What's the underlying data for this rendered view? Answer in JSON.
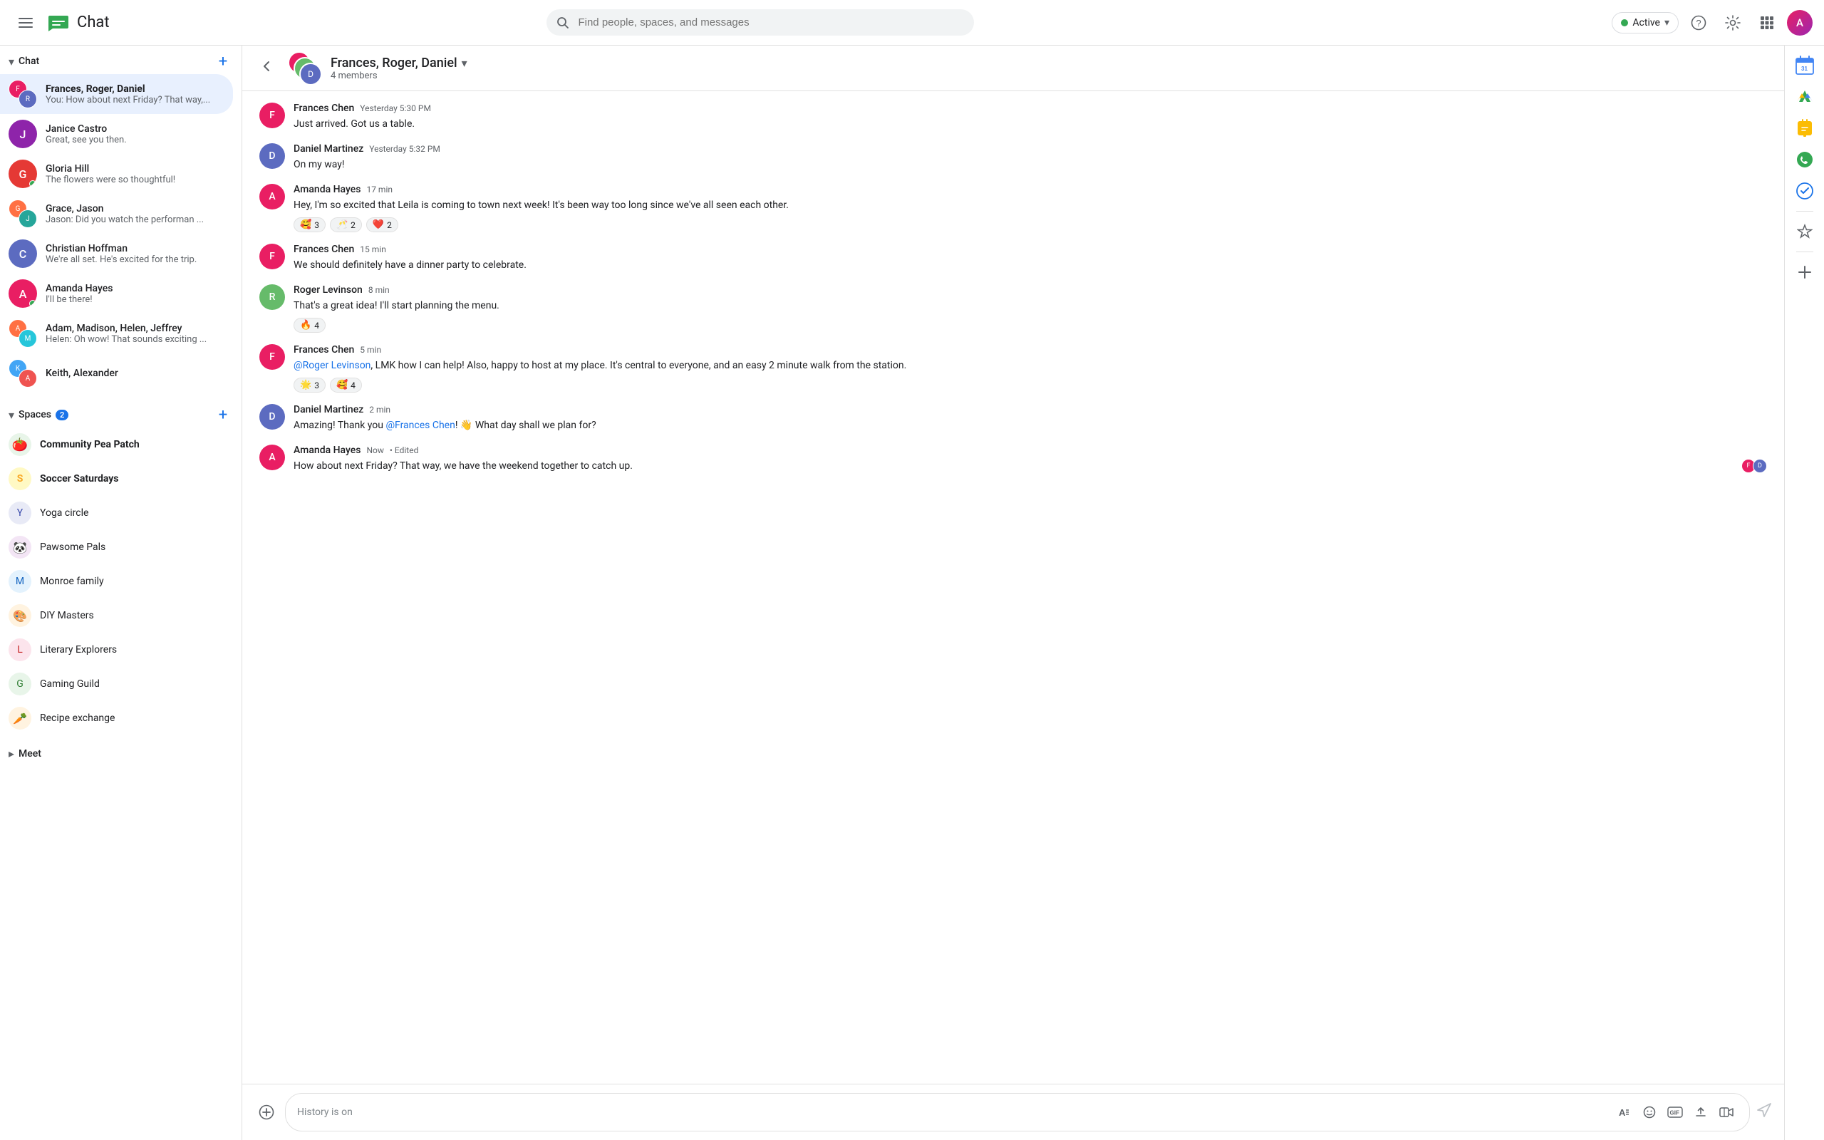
{
  "app": {
    "title": "Chat",
    "logo_color": "#34a853"
  },
  "global_header": {
    "search_placeholder": "Find people, spaces, and messages",
    "status_label": "Active",
    "status_color": "#34a853"
  },
  "sidebar": {
    "chat_section": {
      "label": "Chat",
      "add_icon": "+"
    },
    "spaces_section": {
      "label": "Spaces",
      "badge": "2",
      "add_icon": "+"
    },
    "meet_section": {
      "label": "Meet"
    },
    "conversations": [
      {
        "id": "conv1",
        "name": "Frances, Roger, Daniel",
        "preview": "You: How about next Friday? That way,...",
        "active": true,
        "type": "group",
        "avatar_colors": [
          "#e91e63",
          "#5c6bc0",
          "#66bb6a"
        ]
      },
      {
        "id": "conv2",
        "name": "Janice Castro",
        "preview": "Great, see you then.",
        "active": false,
        "type": "single",
        "avatar_color": "#8e24aa"
      },
      {
        "id": "conv3",
        "name": "Gloria Hill",
        "preview": "The flowers were so thoughtful!",
        "active": false,
        "type": "single",
        "avatar_color": "#e53935",
        "online": true
      },
      {
        "id": "conv4",
        "name": "Grace, Jason",
        "preview": "Jason: Did you watch the performan ...",
        "active": false,
        "type": "group",
        "avatar_colors": [
          "#ff7043",
          "#26a69a"
        ]
      },
      {
        "id": "conv5",
        "name": "Christian Hoffman",
        "preview": "We're all set.  He's excited for the trip.",
        "active": false,
        "type": "single",
        "avatar_color": "#5c6bc0"
      },
      {
        "id": "conv6",
        "name": "Amanda Hayes",
        "preview": "I'll be there!",
        "active": false,
        "type": "single",
        "avatar_color": "#e91e63",
        "online": true
      },
      {
        "id": "conv7",
        "name": "Adam, Madison, Helen, Jeffrey",
        "preview": "Helen: Oh wow! That sounds exciting ...",
        "active": false,
        "type": "group",
        "avatar_colors": [
          "#ff7043",
          "#26c6da",
          "#ab47bc",
          "#66bb6a"
        ]
      },
      {
        "id": "conv8",
        "name": "Keith, Alexander",
        "preview": "",
        "active": false,
        "type": "group",
        "avatar_colors": [
          "#42a5f5",
          "#ef5350"
        ]
      }
    ],
    "spaces": [
      {
        "id": "s1",
        "name": "Community Pea Patch",
        "bold": true,
        "avatar_emoji": "🍅",
        "avatar_bg": "#e8f5e9"
      },
      {
        "id": "s2",
        "name": "Soccer Saturdays",
        "bold": true,
        "avatar_emoji": "S",
        "avatar_bg": "#fff9c4",
        "avatar_color": "#f9a825"
      },
      {
        "id": "s3",
        "name": "Yoga circle",
        "bold": false,
        "avatar_letter": "Y",
        "avatar_bg": "#e8eaf6",
        "avatar_color": "#3949ab"
      },
      {
        "id": "s4",
        "name": "Pawsome Pals",
        "bold": false,
        "avatar_emoji": "🐼",
        "avatar_bg": "#f3e5f5"
      },
      {
        "id": "s5",
        "name": "Monroe family",
        "bold": false,
        "avatar_letter": "M",
        "avatar_bg": "#e3f2fd",
        "avatar_color": "#1565c0"
      },
      {
        "id": "s6",
        "name": "DIY Masters",
        "bold": false,
        "avatar_emoji": "🎨",
        "avatar_bg": "#fff3e0"
      },
      {
        "id": "s7",
        "name": "Literary Explorers",
        "bold": false,
        "avatar_letter": "L",
        "avatar_bg": "#fce4ec",
        "avatar_color": "#c62828"
      },
      {
        "id": "s8",
        "name": "Gaming Guild",
        "bold": false,
        "avatar_letter": "G",
        "avatar_bg": "#e8f5e9",
        "avatar_color": "#2e7d32"
      },
      {
        "id": "s9",
        "name": "Recipe exchange",
        "bold": false,
        "avatar_emoji": "🥕",
        "avatar_bg": "#fff3e0"
      }
    ]
  },
  "chat": {
    "title": "Frances, Roger, Daniel",
    "members_count": "4 members",
    "messages": [
      {
        "id": "m1",
        "sender": "Frances Chen",
        "time": "Yesterday 5:30 PM",
        "text": "Just arrived.  Got us a table.",
        "avatar_color": "#e91e63",
        "reactions": []
      },
      {
        "id": "m2",
        "sender": "Daniel Martinez",
        "time": "Yesterday 5:32 PM",
        "text": "On my way!",
        "avatar_color": "#5c6bc0",
        "reactions": []
      },
      {
        "id": "m3",
        "sender": "Amanda Hayes",
        "time": "17 min",
        "text": "Hey, I'm so excited that Leila is coming to town next week! It's been way too long since we've all seen each other.",
        "avatar_color": "#e91e63",
        "reactions": [
          {
            "emoji": "🥰",
            "count": "3"
          },
          {
            "emoji": "🥂",
            "count": "2"
          },
          {
            "emoji": "❤️",
            "count": "2"
          }
        ]
      },
      {
        "id": "m4",
        "sender": "Frances Chen",
        "time": "15 min",
        "text": "We should definitely have a dinner party to celebrate.",
        "avatar_color": "#e91e63",
        "reactions": []
      },
      {
        "id": "m5",
        "sender": "Roger Levinson",
        "time": "8 min",
        "text": "That's a great idea! I'll start planning the menu.",
        "avatar_color": "#66bb6a",
        "reactions": [
          {
            "emoji": "🔥",
            "count": "4"
          }
        ]
      },
      {
        "id": "m6",
        "sender": "Frances Chen",
        "time": "5 min",
        "text_parts": [
          {
            "type": "mention",
            "text": "@Roger Levinson"
          },
          {
            "type": "plain",
            "text": ", LMK how I can help!  Also, happy to host at my place. It's central to everyone, and an easy 2 minute walk from the station."
          }
        ],
        "avatar_color": "#e91e63",
        "reactions": [
          {
            "emoji": "🌟",
            "count": "3"
          },
          {
            "emoji": "🥰",
            "count": "4"
          }
        ]
      },
      {
        "id": "m7",
        "sender": "Daniel Martinez",
        "time": "2 min",
        "text_parts": [
          {
            "type": "plain",
            "text": "Amazing! Thank you "
          },
          {
            "type": "mention",
            "text": "@Frances Chen"
          },
          {
            "type": "plain",
            "text": "! 👋 What day shall we plan for?"
          }
        ],
        "avatar_color": "#5c6bc0",
        "reactions": []
      },
      {
        "id": "m8",
        "sender": "Amanda Hayes",
        "time": "Now",
        "edited": true,
        "text": "How about next Friday? That way, we have the weekend together to catch up.",
        "avatar_color": "#e91e63",
        "reactions": [],
        "read_avatars": [
          "#e91e63",
          "#5c6bc0"
        ]
      }
    ],
    "input_placeholder": "History is on"
  },
  "right_sidebar": {
    "icons": [
      {
        "name": "google-calendar-icon",
        "color": "#4285f4",
        "symbol": "📅"
      },
      {
        "name": "google-drive-icon",
        "color": "#34a853",
        "symbol": "▲"
      },
      {
        "name": "google-keep-icon",
        "color": "#fbbc04",
        "symbol": "💡"
      },
      {
        "name": "google-phone-icon",
        "color": "#34a853",
        "symbol": "📞"
      },
      {
        "name": "google-tasks-icon",
        "color": "#1a73e8",
        "symbol": "✔"
      },
      {
        "name": "star-icon",
        "color": "#5f6368",
        "symbol": "☆"
      },
      {
        "name": "add-app-icon",
        "color": "#5f6368",
        "symbol": "+"
      }
    ]
  }
}
